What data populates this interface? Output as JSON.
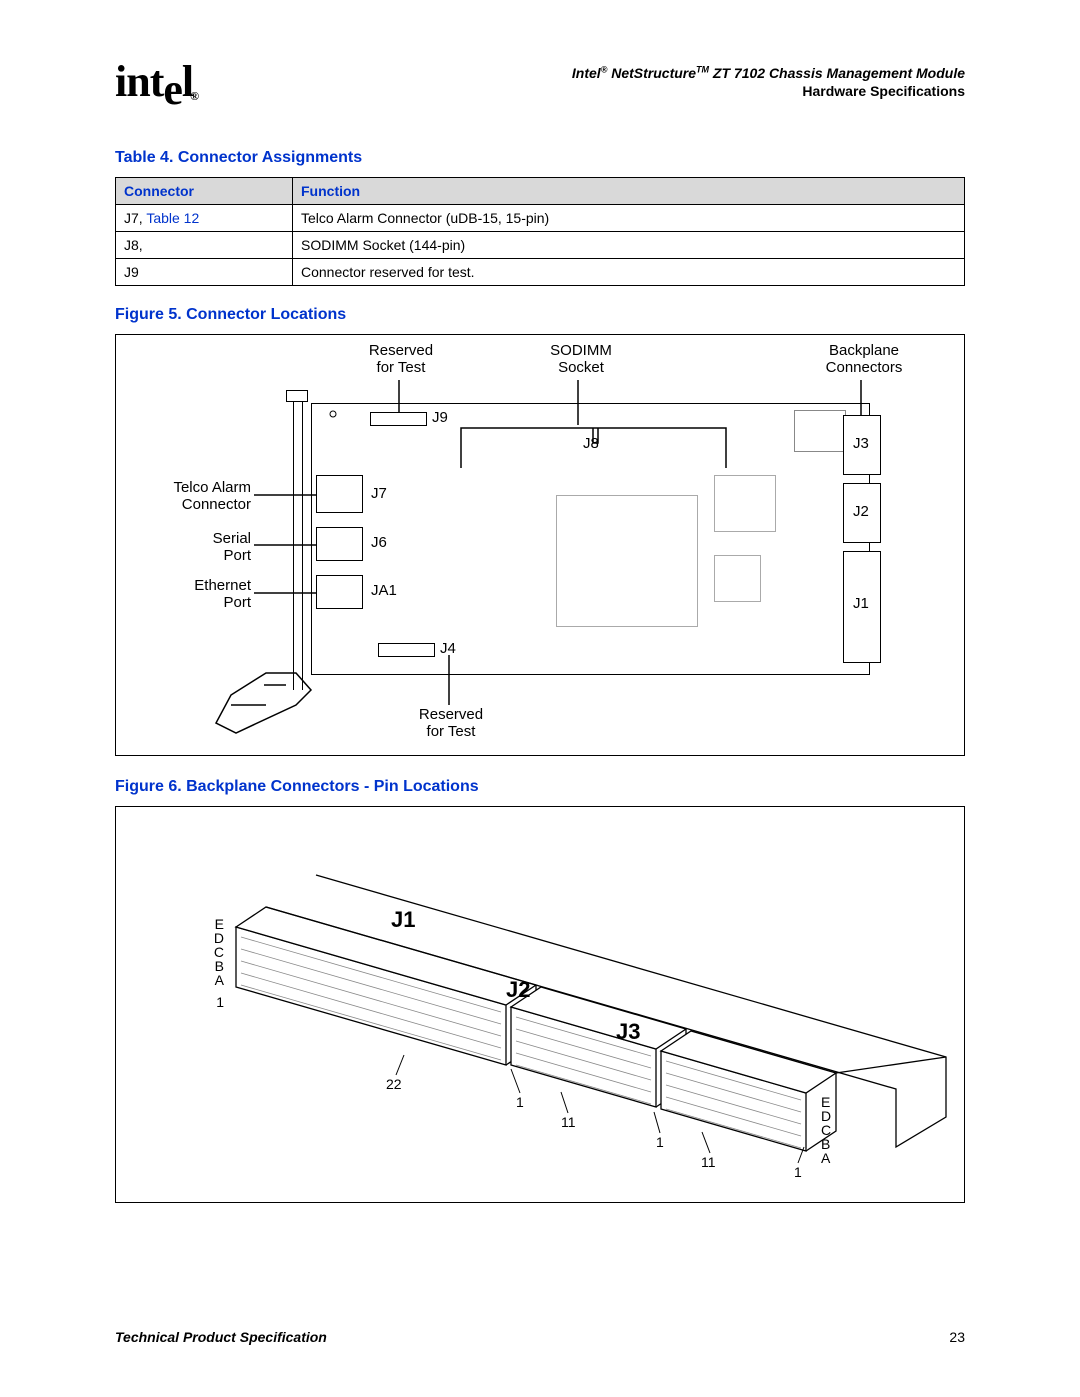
{
  "header": {
    "logo_text": "intel",
    "product_line": "Intel® NetStructure™ ZT 7102 Chassis Management Module",
    "subtitle": "Hardware Specifications"
  },
  "table4": {
    "caption": "Table 4.   Connector Assignments",
    "col1": "Connector",
    "col2": "Function",
    "rows": [
      {
        "c1a": "J7, ",
        "c1b": "Table 12",
        "c2": "Telco Alarm Connector (uDB-15, 15-pin)"
      },
      {
        "c1a": "J8,",
        "c1b": "",
        "c2": "SODIMM Socket (144-pin)"
      },
      {
        "c1a": "J9",
        "c1b": "",
        "c2": "Connector reserved for test."
      }
    ]
  },
  "figure5": {
    "caption": "Figure 5.  Connector Locations",
    "labels": {
      "reserved_top": "Reserved\nfor Test",
      "sodimm": "SODIMM\nSocket",
      "backplane": "Backplane\nConnectors",
      "telco": "Telco Alarm\nConnector",
      "serial": "Serial\nPort",
      "ethernet": "Ethernet\nPort",
      "reserved_bottom": "Reserved\nfor Test",
      "J9": "J9",
      "J8": "J8",
      "J7": "J7",
      "J6": "J6",
      "JA1": "JA1",
      "J4": "J4",
      "J3": "J3",
      "J2": "J2",
      "J1": "J1"
    }
  },
  "figure6": {
    "caption": "Figure 6.  Backplane Connectors - Pin Locations",
    "labels": {
      "J1": "J1",
      "J2": "J2",
      "J3": "J3",
      "rows_left": [
        "E",
        "D",
        "C",
        "B",
        "A"
      ],
      "rows_right": [
        "E",
        "D",
        "C",
        "B",
        "A"
      ],
      "n22": "22",
      "n1a": "1",
      "n11a": "11",
      "n1b": "1",
      "n11b": "11",
      "n1c": "1"
    }
  },
  "footer": {
    "left": "Technical Product Specification",
    "right": "23"
  }
}
